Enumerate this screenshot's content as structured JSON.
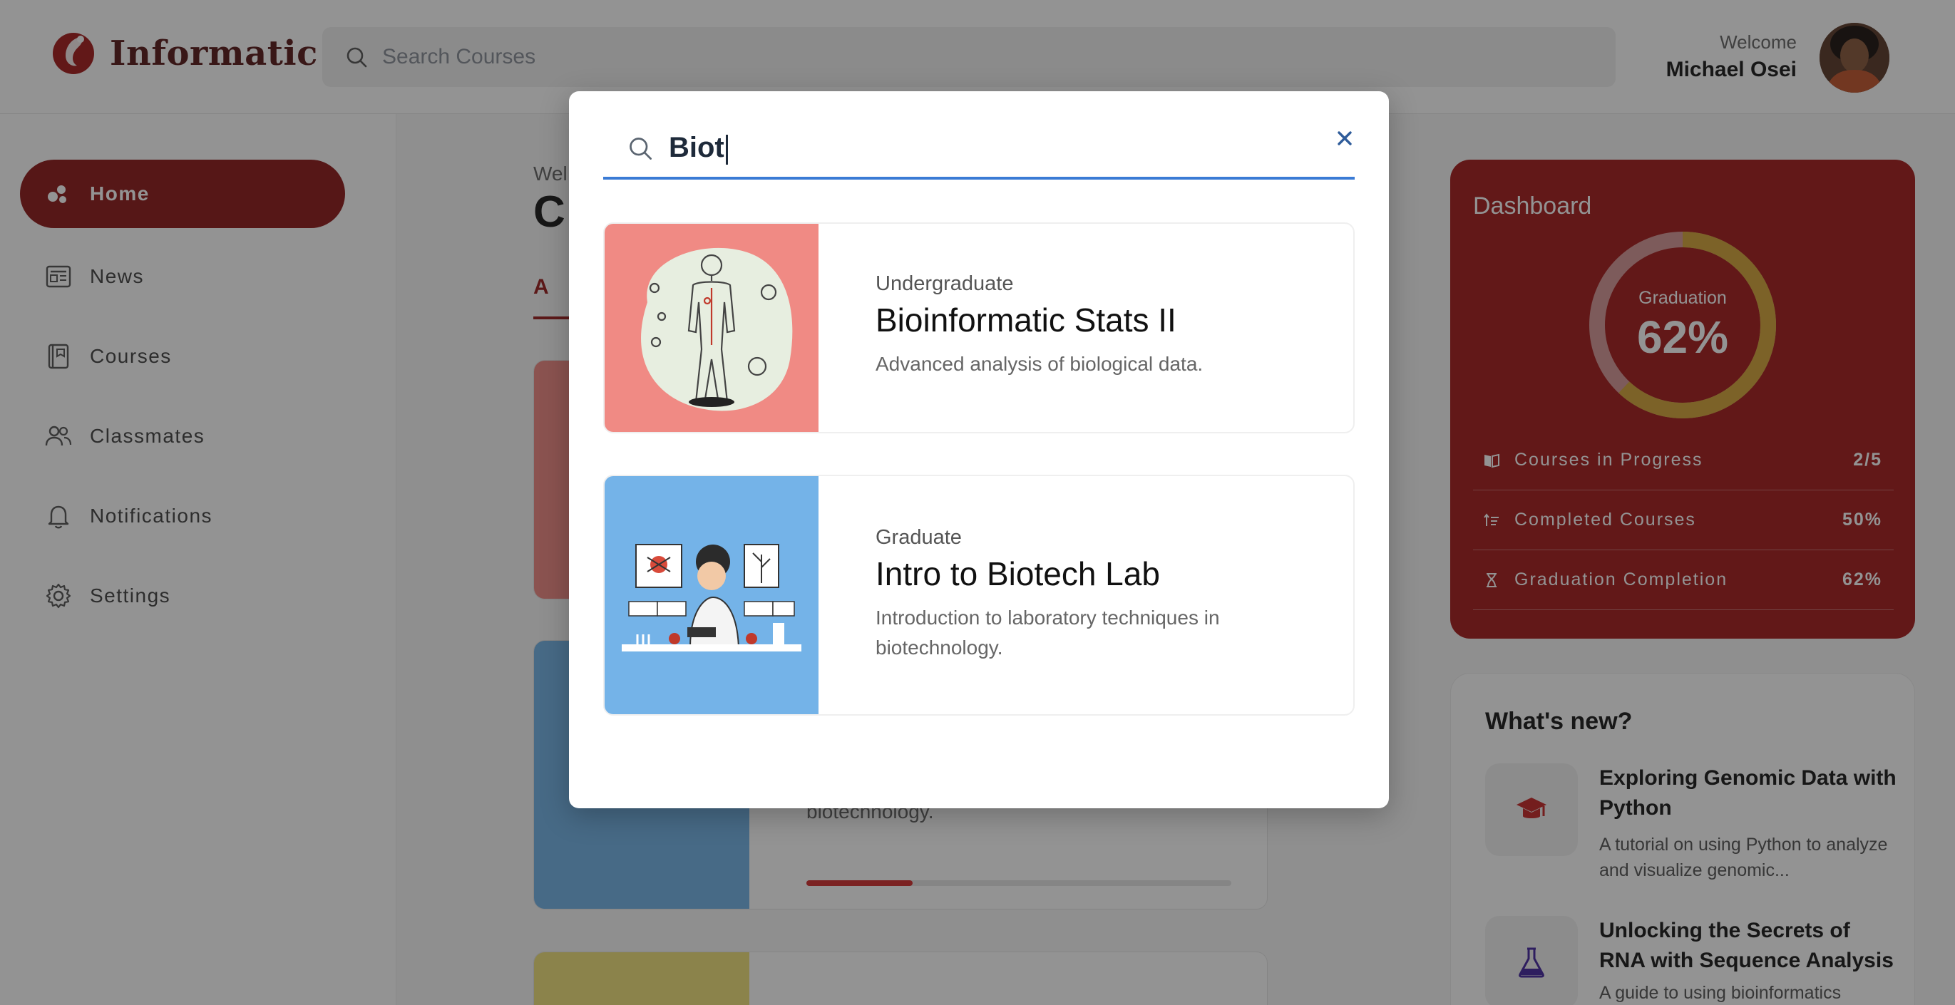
{
  "app": {
    "name": "Informatic"
  },
  "header": {
    "search_placeholder": "Search Courses",
    "welcome_label": "Welcome",
    "user_name": "Michael Osei"
  },
  "sidebar": {
    "items": [
      {
        "label": "Home",
        "icon": "home-icon",
        "active": true
      },
      {
        "label": "News",
        "icon": "newspaper-icon",
        "active": false
      },
      {
        "label": "Courses",
        "icon": "book-icon",
        "active": false
      },
      {
        "label": "Classmates",
        "icon": "users-icon",
        "active": false
      },
      {
        "label": "Notifications",
        "icon": "bell-icon",
        "active": false
      },
      {
        "label": "Settings",
        "icon": "gear-icon",
        "active": false
      }
    ]
  },
  "main": {
    "greeting_partial": "Wel",
    "title_partial": "C",
    "tab_partial": "A",
    "card2_desc_partial": "biotechnology.",
    "card2_progress": 0.25
  },
  "dashboard": {
    "title": "Dashboard",
    "ring_label": "Graduation",
    "ring_value": "62%",
    "ring_fraction": 0.62,
    "rows": [
      {
        "icon": "book-open-icon",
        "label": "Courses in Progress",
        "value": "2/5"
      },
      {
        "icon": "sort-list-icon",
        "label": "Completed Courses",
        "value": "50%"
      },
      {
        "icon": "hourglass-icon",
        "label": "Graduation Completion",
        "value": "62%"
      }
    ]
  },
  "whats_new": {
    "title": "What's new?",
    "items": [
      {
        "icon": "graduation-cap-icon",
        "title": "Exploring Genomic Data with Python",
        "desc": "A tutorial on using Python to analyze and visualize genomic..."
      },
      {
        "icon": "flask-icon",
        "title": "Unlocking the Secrets of RNA with Sequence Analysis",
        "desc": "A guide to using bioinformatics"
      }
    ]
  },
  "search_modal": {
    "query": "Biot",
    "results": [
      {
        "level": "Undergraduate",
        "title": "Bioinformatic Stats II",
        "desc": "Advanced analysis of biological data.",
        "thumb_color": "#f08a84"
      },
      {
        "level": "Graduate",
        "title": "Intro to Biotech Lab",
        "desc": "Introduction to laboratory techniques in biotechnology.",
        "thumb_color": "#74b3e8"
      }
    ]
  },
  "colors": {
    "brand": "#a51c1c",
    "nav_active": "#8e1a1a",
    "focus_blue": "#3a7bd5",
    "ring_progress": "#d4a53a"
  }
}
